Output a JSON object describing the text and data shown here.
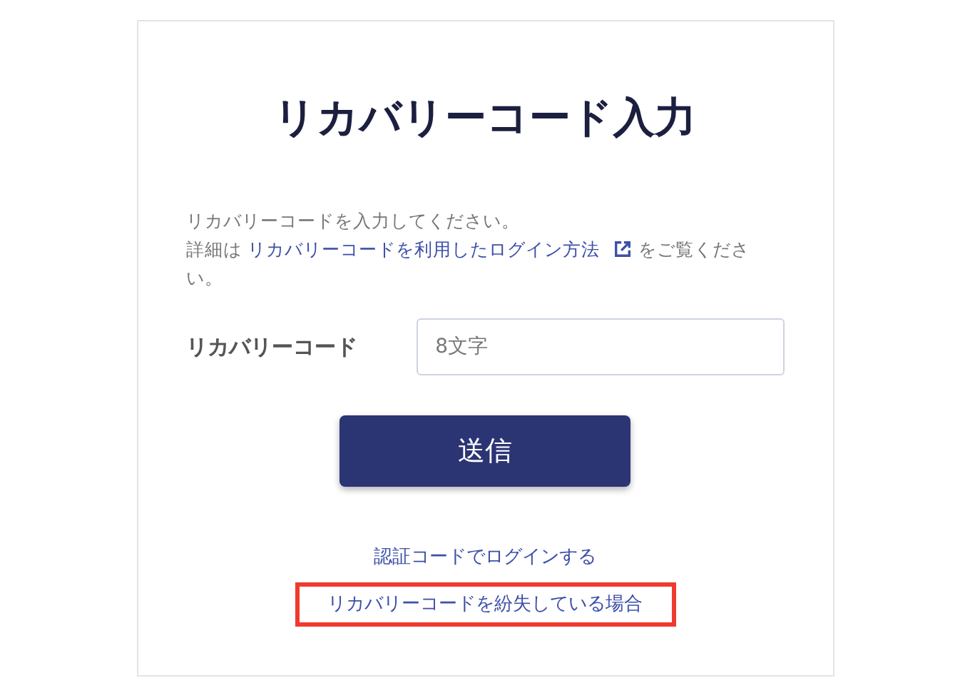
{
  "title": "リカバリーコード入力",
  "intro": {
    "line1": "リカバリーコードを入力してください。",
    "prefix": "詳細は",
    "link": "リカバリーコードを利用したログイン方法",
    "suffix": "をご覧ください。"
  },
  "field": {
    "label": "リカバリーコード",
    "placeholder": "8文字"
  },
  "submit": "送信",
  "links": [
    {
      "text": "認証コードでログインする",
      "highlighted": false
    },
    {
      "text": "リカバリーコードを紛失している場合",
      "highlighted": true
    }
  ]
}
